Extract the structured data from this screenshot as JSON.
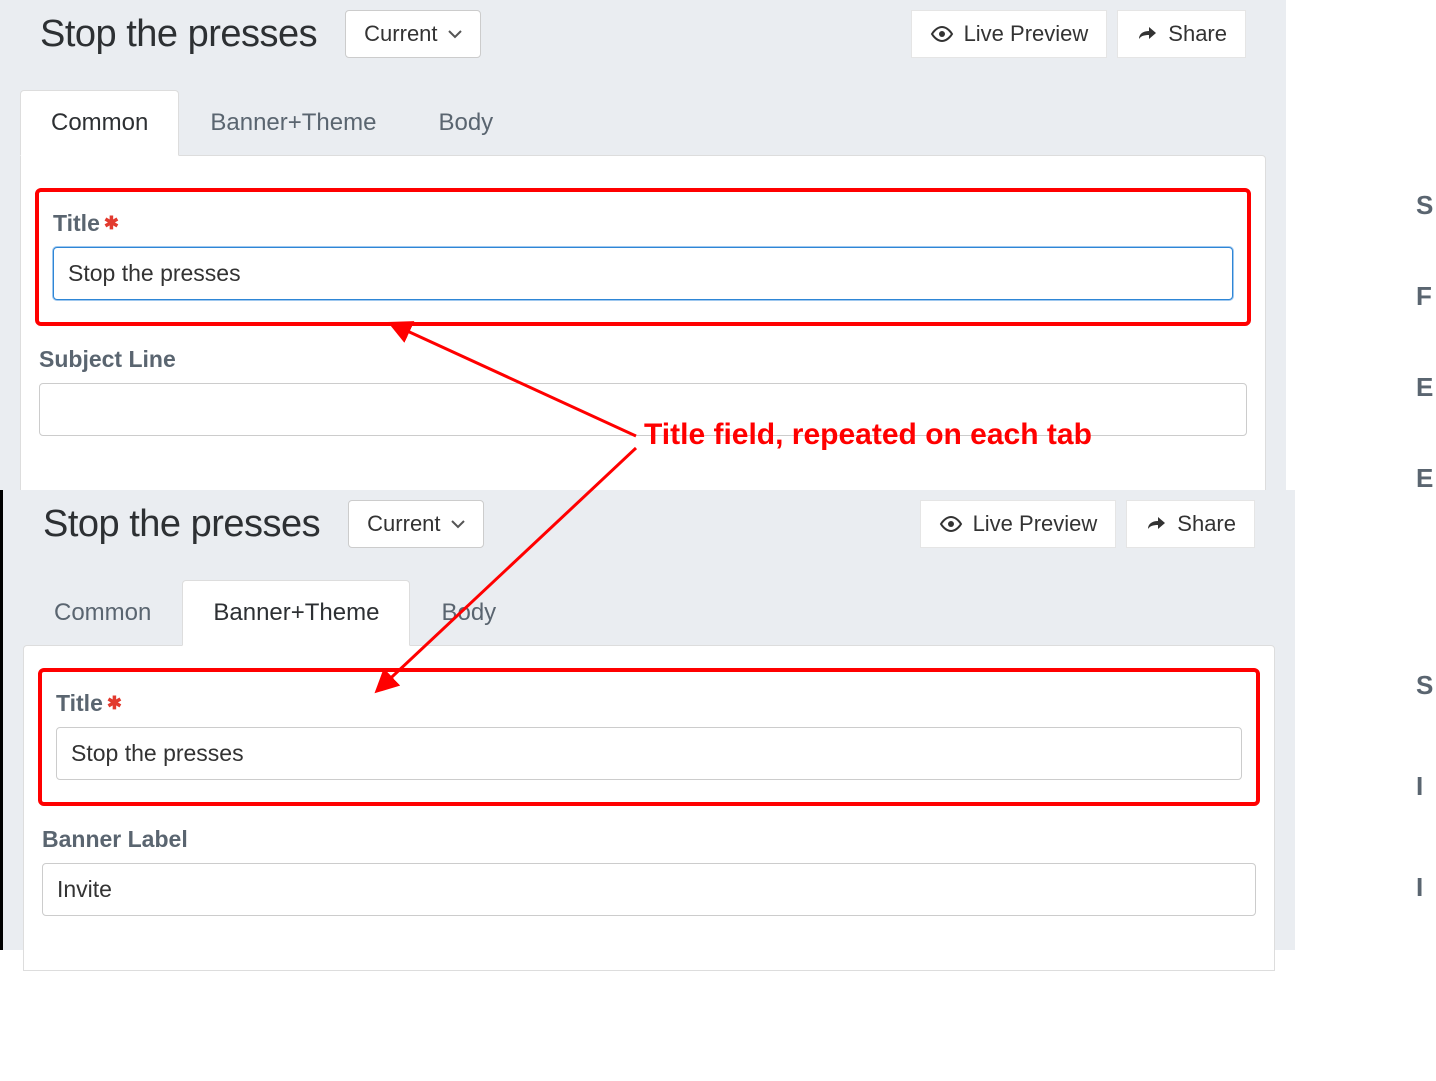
{
  "header": {
    "title": "Stop the presses",
    "version_label": "Current",
    "live_preview": "Live Preview",
    "share": "Share"
  },
  "tabs": {
    "common": "Common",
    "banner_theme": "Banner+Theme",
    "body": "Body"
  },
  "top": {
    "title_label": "Title",
    "title_value": "Stop the presses",
    "subject_label": "Subject Line",
    "subject_value": ""
  },
  "bottom": {
    "title_label": "Title",
    "title_value": "Stop the presses",
    "banner_label_label": "Banner Label",
    "banner_label_value": "Invite"
  },
  "annotation": "Title field, repeated on each tab",
  "edge_top": [
    "S",
    "F",
    "E",
    "E"
  ],
  "edge_bot": [
    "S",
    "I",
    "I"
  ]
}
